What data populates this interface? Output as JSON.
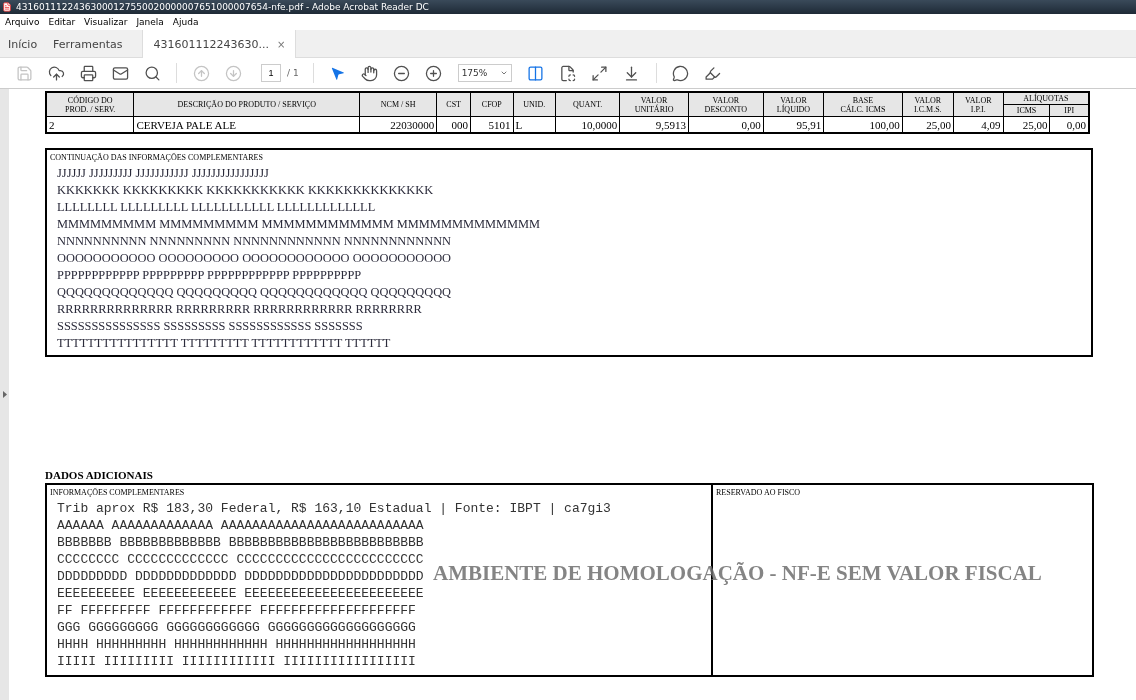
{
  "window": {
    "title": "43160111224363000127550020000007651000007654-nfe.pdf - Adobe Acrobat Reader DC"
  },
  "menu": [
    "Arquivo",
    "Editar",
    "Visualizar",
    "Janela",
    "Ajuda"
  ],
  "tabs": [
    {
      "label": "Início",
      "selected": false,
      "closable": false
    },
    {
      "label": "Ferramentas",
      "selected": false,
      "closable": false
    },
    {
      "label": "431601112243630...",
      "selected": true,
      "closable": true,
      "close": "×"
    }
  ],
  "toolbar": {
    "left": [
      {
        "kind": "save",
        "disabled": true,
        "active": false
      },
      {
        "kind": "upload",
        "disabled": false,
        "active": false
      },
      {
        "kind": "print",
        "disabled": false,
        "active": false
      },
      {
        "kind": "mail",
        "disabled": false,
        "active": false
      },
      {
        "kind": "search",
        "disabled": false,
        "active": false
      }
    ],
    "nav": [
      {
        "kind": "prev",
        "disabled": true,
        "active": false
      },
      {
        "kind": "next",
        "disabled": true,
        "active": false
      }
    ],
    "page": "1",
    "page_total": "/ 1",
    "tools": [
      {
        "kind": "pointer",
        "disabled": false,
        "active": true
      },
      {
        "kind": "hand",
        "disabled": false,
        "active": false
      },
      {
        "kind": "zoomout",
        "disabled": false,
        "active": false
      },
      {
        "kind": "zoomin",
        "disabled": false,
        "active": false
      }
    ],
    "zoom": "175%",
    "view": [
      {
        "kind": "fitwidth",
        "disabled": false,
        "active": true
      },
      {
        "kind": "fitpage",
        "disabled": false,
        "active": false
      },
      {
        "kind": "fullscreen",
        "disabled": false,
        "active": false
      },
      {
        "kind": "scroll",
        "disabled": false,
        "active": false
      }
    ],
    "annotate": [
      {
        "kind": "comment",
        "disabled": false,
        "active": false
      },
      {
        "kind": "highlight",
        "disabled": false,
        "active": false
      }
    ]
  },
  "items_table": {
    "columns": [
      "CÓDIGO DO\nPROD. / SERV.",
      "DESCRIÇÃO DO PRODUTO / SERVIÇO",
      "NCM / SH",
      "CST",
      "CFOP",
      "UNID.",
      "QUANT.",
      "VALOR\nUNITÁRIO",
      "VALOR\nDESCONTO",
      "VALOR\nLÍQUIDO",
      "BASE\nCÁLC. ICMS",
      "VALOR\nI.C.M.S.",
      "VALOR\nI.P.I."
    ],
    "group": "ALÍQUOTAS",
    "group_columns": [
      "ICMS",
      "IPI"
    ],
    "rows": [
      [
        "2",
        "CERVEJA PALE ALE",
        "22030000",
        "000",
        "5101",
        "L",
        "10,0000",
        "9,5913",
        "0,00",
        "95,91",
        "100,00",
        "25,00",
        "4,09",
        "25,00",
        "0,00"
      ]
    ]
  },
  "continuation": {
    "title": "CONTINUAÇÃO DAS INFORMAÇÕES COMPLEMENTARES",
    "lines": [
      "JJJJJJ JJJJJJJJJ JJJJJJJJJJJ JJJJJJJJJJJJJJJJ",
      "KKKKKKK KKKKKKKKK KKKKKKKKKKK KKKKKKKKKKKKKK",
      "LLLLLLLL LLLLLLLLL LLLLLLLLLLL LLLLLLLLLLLLL",
      "MMMMMMMMM MMMMMMMMM MMMMMMMMMMMM MMMMMMMMMMMMM",
      "NNNNNNNNNN NNNNNNNNN NNNNNNNNNNNN NNNNNNNNNNNN",
      "OOOOOOOOOOO OOOOOOOOO OOOOOOOOOOOO OOOOOOOOOOO",
      "PPPPPPPPPPPP PPPPPPPPP PPPPPPPPPPPP PPPPPPPPPP",
      "QQQQQQQQQQQQQ QQQQQQQQQ QQQQQQQQQQQQ QQQQQQQQQ",
      "RRRRRRRRRRRRRR RRRRRRRRR RRRRRRRRRRRR RRRRRRRR",
      "SSSSSSSSSSSSSSS SSSSSSSSS SSSSSSSSSSSS SSSSSSS",
      "TTTTTTTTTTTTTTTT TTTTTTTTT TTTTTTTTTTTT TTTTTT"
    ]
  },
  "dados_adicionais": {
    "title": "DADOS ADICIONAIS",
    "info_title": "INFORMAÇÕES COMPLEMENTARES",
    "lines": [
      "Trib aprox R$ 183,30 Federal, R$ 163,10 Estadual | Fonte: IBPT | ca7gi3",
      "AAAAAA AAAAAAAAAAAAA AAAAAAAAAAAAAAAAAAAAAAAAAA",
      "BBBBBBB BBBBBBBBBBBBB BBBBBBBBBBBBBBBBBBBBBBBBB",
      "CCCCCCCC CCCCCCCCCCCCC CCCCCCCCCCCCCCCCCCCCCCCC",
      "DDDDDDDDD DDDDDDDDDDDDD DDDDDDDDDDDDDDDDDDDDDDD",
      "EEEEEEEEEE EEEEEEEEEEEE EEEEEEEEEEEEEEEEEEEEEEE",
      "FF FFFFFFFFF FFFFFFFFFFFF FFFFFFFFFFFFFFFFFFFF",
      "GGG GGGGGGGGG GGGGGGGGGGGG GGGGGGGGGGGGGGGGGGG",
      "HHHH HHHHHHHHH HHHHHHHHHHHH HHHHHHHHHHHHHHHHHH",
      "IIIII IIIIIIIII IIIIIIIIIIII IIIIIIIIIIIIIIIII"
    ],
    "reserved_title": "RESERVADO AO FISCO",
    "stamp": "AMBIENTE DE HOMOLOGAÇÃO - NF-E SEM VALOR FISCAL"
  }
}
